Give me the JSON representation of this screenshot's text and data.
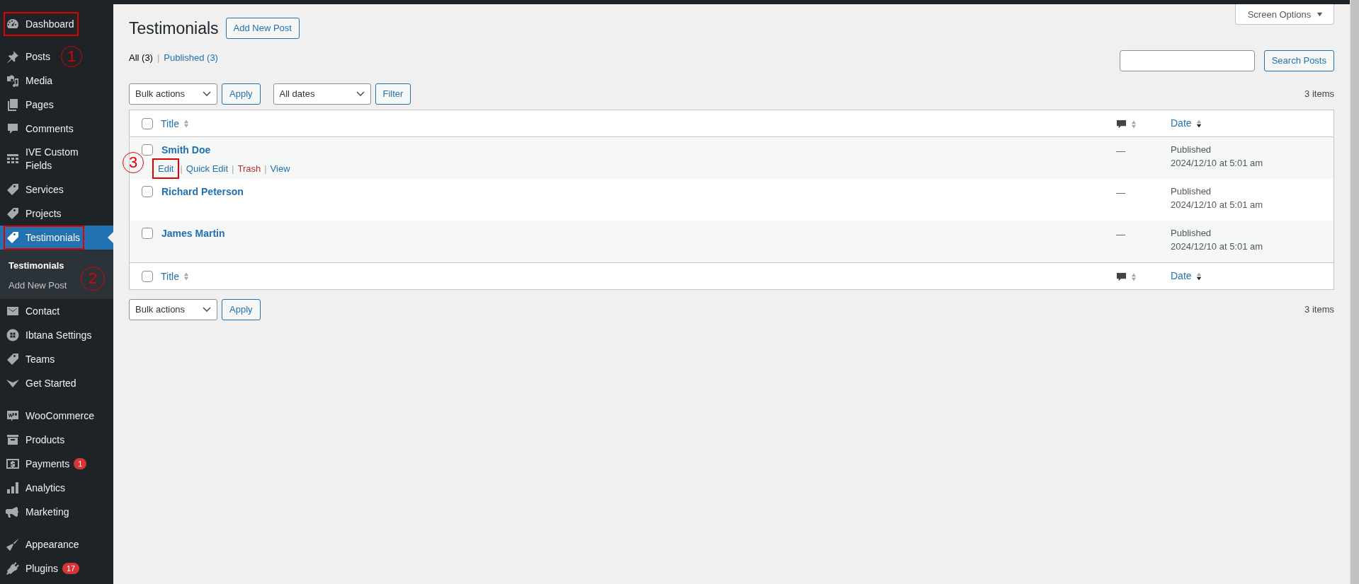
{
  "sidebar": {
    "groups": [
      [
        {
          "label": "Dashboard",
          "selected": false,
          "highlighted": true
        }
      ],
      [
        {
          "label": "Posts",
          "selected": false,
          "highlighted": false,
          "callout": "1"
        },
        {
          "label": "Media",
          "selected": false,
          "highlighted": false
        },
        {
          "label": "Pages",
          "selected": false,
          "highlighted": false
        },
        {
          "label": "Comments",
          "selected": false,
          "highlighted": false
        },
        {
          "label": "IVE Custom Fields",
          "selected": false,
          "highlighted": false
        },
        {
          "label": "Services",
          "selected": false,
          "highlighted": false
        },
        {
          "label": "Projects",
          "selected": false,
          "highlighted": false
        },
        {
          "label": "Testimonials",
          "selected": true,
          "highlighted": true,
          "children": [
            {
              "label": "Testimonials",
              "selected": true
            },
            {
              "label": "Add New Post",
              "selected": false,
              "callout": "2"
            }
          ]
        },
        {
          "label": "Contact",
          "selected": false,
          "highlighted": false
        },
        {
          "label": "Ibtana Settings",
          "selected": false,
          "highlighted": false
        },
        {
          "label": "Teams",
          "selected": false,
          "highlighted": false
        },
        {
          "label": "Get Started",
          "selected": false,
          "highlighted": false
        }
      ],
      [
        {
          "label": "WooCommerce",
          "selected": false,
          "highlighted": false
        },
        {
          "label": "Products",
          "selected": false,
          "highlighted": false
        },
        {
          "label": "Payments",
          "selected": false,
          "highlighted": false,
          "badge": "1"
        },
        {
          "label": "Analytics",
          "selected": false,
          "highlighted": false
        },
        {
          "label": "Marketing",
          "selected": false,
          "highlighted": false
        }
      ],
      [
        {
          "label": "Appearance",
          "selected": false,
          "highlighted": false
        },
        {
          "label": "Plugins",
          "selected": false,
          "highlighted": false,
          "badge": "17"
        }
      ]
    ]
  },
  "header": {
    "title": "Testimonials",
    "add_button": "Add New Post",
    "screen_options": "Screen Options"
  },
  "views": {
    "separator": "|",
    "items": [
      {
        "label": "All",
        "count": "(3)",
        "selected": true
      },
      {
        "label": "Published",
        "count": "(3)",
        "selected": false
      }
    ]
  },
  "search": {
    "button": "Search Posts"
  },
  "top_nav": {
    "bulk_actions": "Bulk actions",
    "apply": "Apply",
    "date_filter": "All dates",
    "filter": "Filter",
    "count": "3 items"
  },
  "table": {
    "header_columns": [
      {
        "kind": "title",
        "label": "Title",
        "sorted": false
      },
      {
        "kind": "comments",
        "sorted": false
      },
      {
        "kind": "date",
        "label": "Date",
        "sorted": true
      }
    ],
    "header_checked": false,
    "rows": [
      {
        "title": "Smith Doe",
        "checked": false,
        "comments": "—",
        "status": "Published",
        "date": "2024/12/10 at 5:01 am",
        "callout": "3",
        "action_separator": "|",
        "actions": [
          {
            "label": "Edit",
            "kind": "edit",
            "highlighted": true
          },
          {
            "label": "Quick Edit",
            "kind": "link",
            "highlighted": false
          },
          {
            "label": "Trash",
            "kind": "trash",
            "highlighted": false
          },
          {
            "label": "View",
            "kind": "link",
            "highlighted": false
          }
        ]
      },
      {
        "title": "Richard Peterson",
        "checked": false,
        "comments": "—",
        "status": "Published",
        "date": "2024/12/10 at 5:01 am"
      },
      {
        "title": "James Martin",
        "checked": false,
        "comments": "—",
        "status": "Published",
        "date": "2024/12/10 at 5:01 am"
      }
    ],
    "footer_columns": [
      {
        "kind": "title",
        "label": "Title",
        "sorted": false
      },
      {
        "kind": "comments",
        "sorted": false
      },
      {
        "kind": "date",
        "label": "Date",
        "sorted": true
      }
    ],
    "footer_checked": false
  },
  "bottom_nav": {
    "bulk_actions": "Bulk actions",
    "apply": "Apply",
    "count": "3 items"
  }
}
